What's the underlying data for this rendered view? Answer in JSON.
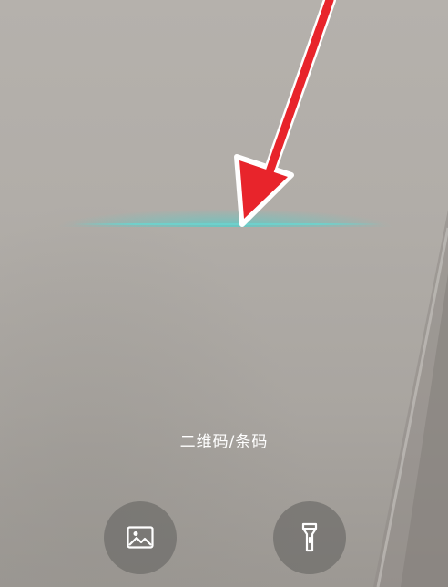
{
  "scanner": {
    "mode_label": "二维码/条码"
  },
  "controls": {
    "gallery_icon": "image-icon",
    "flashlight_icon": "flashlight-icon"
  },
  "colors": {
    "scan_line": "#58cdc8",
    "annotation_arrow": "#e8242b",
    "button_bg": "#6e6c69"
  }
}
